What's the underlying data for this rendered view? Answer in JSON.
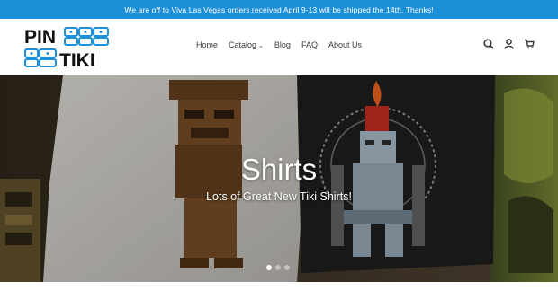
{
  "announcement": {
    "text": "We are off to Viva Las Vegas orders received April 9-13 will be shipped the 14th.  Thanks!",
    "bg_color": "#1c8fd6"
  },
  "logo": {
    "line1": "PIN",
    "line2": "TIKI",
    "accent_color": "#1c8fd6"
  },
  "nav": {
    "items": [
      {
        "label": "Home"
      },
      {
        "label": "Catalog"
      },
      {
        "label": "Blog"
      },
      {
        "label": "FAQ"
      },
      {
        "label": "About Us"
      }
    ]
  },
  "header_icons": [
    "search-icon",
    "account-icon",
    "cart-icon"
  ],
  "hero": {
    "title": "Shirts",
    "subtitle": "Lots of Great New Tiki Shirts!",
    "slides": 3,
    "active_slide": 1
  }
}
